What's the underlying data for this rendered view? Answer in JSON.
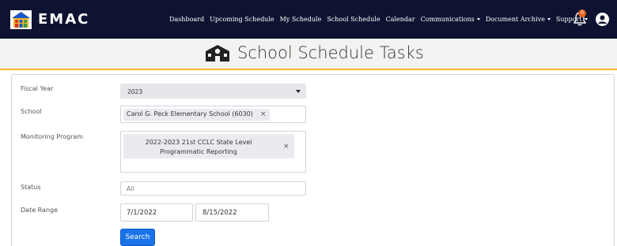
{
  "app": {
    "brand": "EMAC"
  },
  "nav": {
    "items": [
      {
        "label": "Dashboard",
        "dropdown": false
      },
      {
        "label": "Upcoming Schedule",
        "dropdown": false
      },
      {
        "label": "My Schedule",
        "dropdown": false
      },
      {
        "label": "School Schedule",
        "dropdown": false
      },
      {
        "label": "Calendar",
        "dropdown": false
      },
      {
        "label": "Communications",
        "dropdown": true
      },
      {
        "label": "Document Archive",
        "dropdown": true
      },
      {
        "label": "Support",
        "dropdown": true
      }
    ],
    "notification_count": "0",
    "icons": {
      "notifications": "bell-icon",
      "user": "user-circle-icon"
    }
  },
  "page": {
    "title": "School Schedule Tasks",
    "title_icon": "school-building-icon"
  },
  "form": {
    "fiscal_year": {
      "label": "Fiscal Year",
      "value": "2023"
    },
    "school": {
      "label": "School",
      "tag": "Carol G. Peck Elementary School (6030)",
      "remove": "×"
    },
    "monitoring_program": {
      "label": "Monitoring Program",
      "tag_line1": "2022-2023 21st CCLC State Level",
      "tag_line2": "Programmatic Reporting",
      "remove": "×"
    },
    "status": {
      "label": "Status",
      "placeholder": "All"
    },
    "date_range": {
      "label": "Date Range",
      "start": "7/1/2022",
      "end": "8/15/2022"
    },
    "search_button": "Search"
  },
  "colors": {
    "navbar": "#0d1330",
    "accent": "#f2b531",
    "button": "#1a73e8",
    "badge": "#e5621d"
  }
}
